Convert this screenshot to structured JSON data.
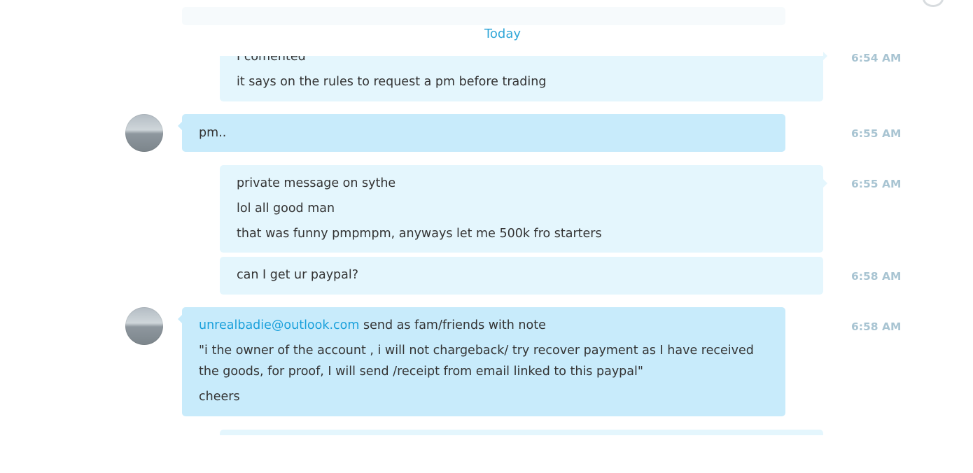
{
  "date_separator": "Today",
  "messages": [
    {
      "id": "m1",
      "lines": [
        "I comented",
        "it says on the rules to request a pm before trading"
      ],
      "time": "6:54 AM"
    },
    {
      "id": "m2",
      "lines": [
        "pm.."
      ],
      "time": "6:55 AM"
    },
    {
      "id": "m3",
      "lines": [
        "private message on sythe",
        "lol all good man",
        "that was funny pmpmpm, anyways let me 500k fro starters"
      ],
      "time": "6:55 AM"
    },
    {
      "id": "m4",
      "lines": [
        "can I get ur paypal?"
      ],
      "time": "6:58 AM"
    },
    {
      "id": "m5",
      "email": "unrealbadie@outlook.com",
      "email_suffix": " send as fam/friends with note",
      "quote_line1": "\"i the owner of the account , i will not chargeback/ try recover payment as I have received",
      "quote_line2": "the goods, for proof, I will send /receipt from email linked to this paypal\"",
      "closing": "cheers",
      "time": "6:58 AM"
    }
  ]
}
